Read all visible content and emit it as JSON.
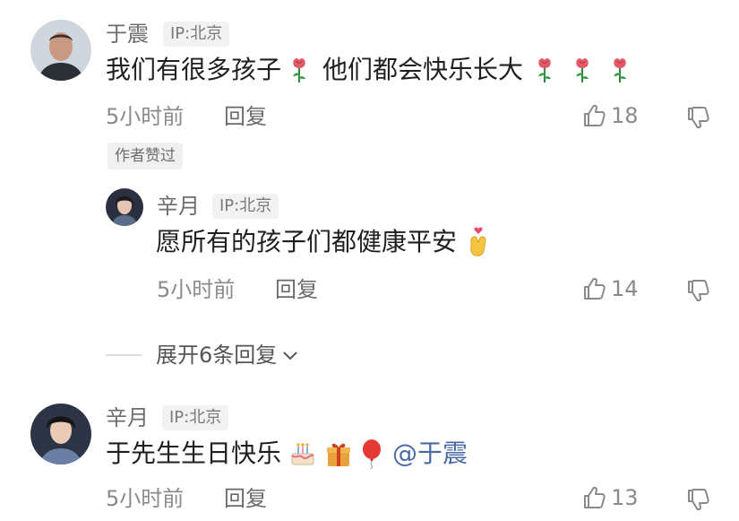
{
  "comments": [
    {
      "user": "于震",
      "ip": "IP:北京",
      "text": "我们有很多孩子",
      "text2": "他们都会快乐长大",
      "time": "5小时前",
      "reply_label": "回复",
      "likes": "18",
      "author_badge": "作者赞过"
    },
    {
      "user": "辛月",
      "ip": "IP:北京",
      "text": "愿所有的孩子们都健康平安",
      "time": "5小时前",
      "reply_label": "回复",
      "likes": "14"
    },
    {
      "user": "辛月",
      "ip": "IP:北京",
      "text": "于先生生日快乐",
      "mention": "@于震",
      "time": "5小时前",
      "reply_label": "回复",
      "likes": "13"
    }
  ],
  "expand_label": "展开6条回复",
  "icons": {
    "thumb_up": "thumb-up-icon",
    "thumb_down": "thumb-down-icon",
    "rose": "rose-icon",
    "hand_heart": "finger-heart-icon",
    "cake": "cake-icon",
    "gift": "gift-icon",
    "balloon": "balloon-icon",
    "chevron": "chevron-down-icon"
  },
  "colors": {
    "mention": "#4a6aa3",
    "rose": "#e05a6a"
  }
}
